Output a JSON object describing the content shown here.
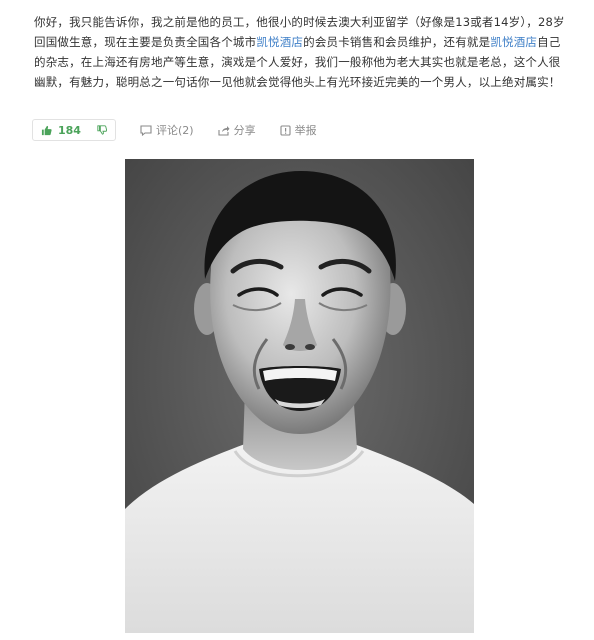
{
  "answer": {
    "seg1": "你好，我只能告诉你，我之前是他的员工，他很小的时候去澳大利亚留学（好像是13或者14岁），28岁回国做生意，现在主要是负责全国各个城市",
    "link1": "凯悦酒店",
    "seg2": "的会员卡销售和会员维护，还有就是",
    "link2": "凯悦酒店",
    "seg3": "自己的杂志，在上海还有房地产等生意，演戏是个人爱好，我们一般称他为老大其实也就是老总，这个人很幽默，有魅力，聪明总之一句话你一见他就会觉得他头上有光环接近完美的一个男人，以上绝对属实！"
  },
  "actions": {
    "like_count": "184",
    "comment_label": "评论(2)",
    "share_label": "分享",
    "report_label": "举报"
  },
  "icons": {
    "thumbs_up": "thumbs-up-icon",
    "thumbs_down": "thumbs-down-icon",
    "comment": "comment-icon",
    "share": "share-icon",
    "report": "report-icon"
  },
  "colors": {
    "link": "#3f7fc7",
    "like": "#4ba35a",
    "muted": "#8a8a8a",
    "text": "#333333"
  }
}
